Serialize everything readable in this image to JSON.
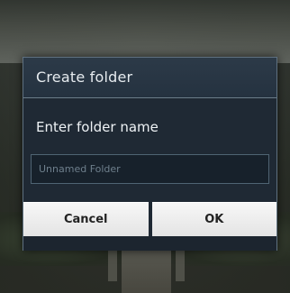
{
  "dialog": {
    "title": "Create folder",
    "prompt": "Enter folder name",
    "input": {
      "placeholder": "Unnamed Folder",
      "value": ""
    },
    "buttons": {
      "cancel": "Cancel",
      "ok": "OK"
    }
  },
  "colors": {
    "dialog_bg": "#1f2934",
    "header_bg": "#2c3a48",
    "button_bg": "#eeeeee"
  }
}
